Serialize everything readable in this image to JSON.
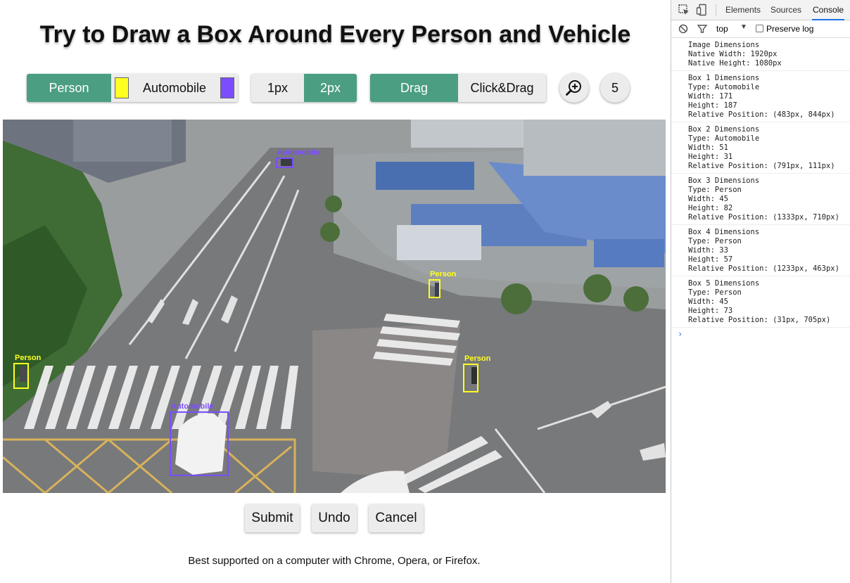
{
  "title": "Try to Draw a Box Around Every Person and Vehicle",
  "toolbar": {
    "person_label": "Person",
    "automobile_label": "Automobile",
    "person_color": "#ffff22",
    "automobile_color": "#7b4dff",
    "px1_label": "1px",
    "px2_label": "2px",
    "drag_label": "Drag",
    "clickdrag_label": "Click&Drag",
    "zoom_icon": "zoom-in-icon",
    "count": "5"
  },
  "boxes": [
    {
      "type": "Person",
      "color": "#ffff22"
    },
    {
      "type": "Automobile",
      "color": "#7b4dff"
    },
    {
      "type": "Person",
      "color": "#ffff22"
    },
    {
      "type": "Person",
      "color": "#ffff22"
    },
    {
      "type": "Automobile",
      "color": "#7b4dff"
    }
  ],
  "actions": {
    "submit": "Submit",
    "undo": "Undo",
    "cancel": "Cancel"
  },
  "footer_note": "Best supported on a computer with Chrome, Opera, or Firefox.",
  "devtools": {
    "tabs": [
      "Elements",
      "Sources",
      "Console"
    ],
    "active_tab": "Console",
    "context": "top",
    "preserve_log_label": "Preserve log",
    "prompt": "›",
    "logs": [
      "Image Dimensions\nNative Width: 1920px\nNative Height: 1080px",
      "Box 1 Dimensions\nType: Automobile\nWidth: 171\nHeight: 187\nRelative Position: (483px, 844px)",
      "Box 2 Dimensions\nType: Automobile\nWidth: 51\nHeight: 31\nRelative Position: (791px, 111px)",
      "Box 3 Dimensions\nType: Person\nWidth: 45\nHeight: 82\nRelative Position: (1333px, 710px)",
      "Box 4 Dimensions\nType: Person\nWidth: 33\nHeight: 57\nRelative Position: (1233px, 463px)",
      "Box 5 Dimensions\nType: Person\nWidth: 45\nHeight: 73\nRelative Position: (31px, 705px)"
    ]
  }
}
